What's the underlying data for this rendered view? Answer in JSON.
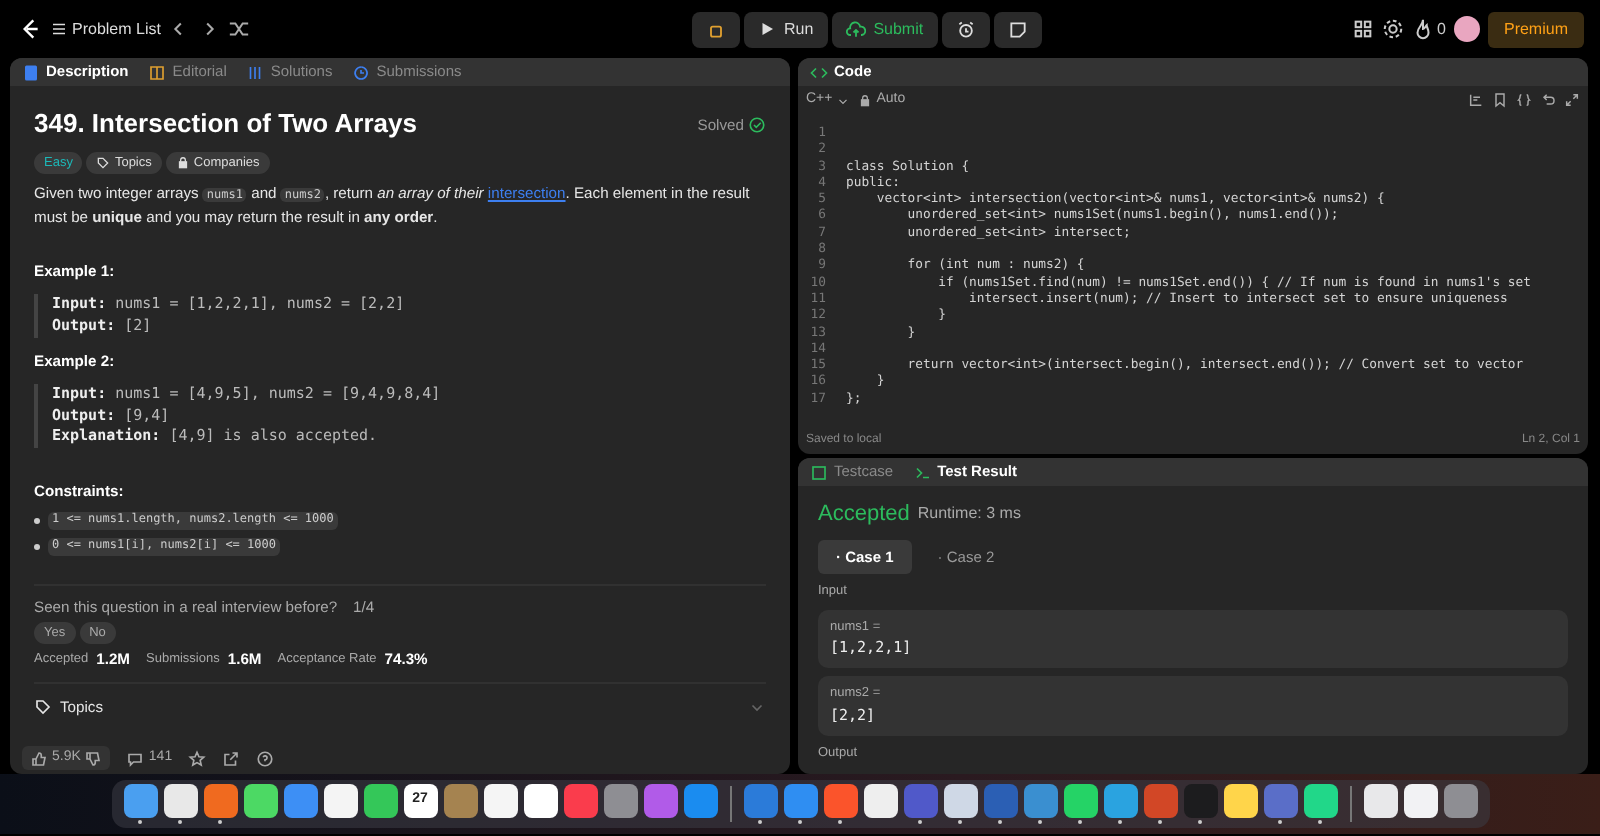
{
  "topbar": {
    "problem_list": "Problem List",
    "run": "Run",
    "submit": "Submit",
    "streak": "0",
    "premium": "Premium"
  },
  "left_tabs": [
    {
      "label": "Description",
      "selected": true
    },
    {
      "label": "Editorial",
      "selected": false
    },
    {
      "label": "Solutions",
      "selected": false
    },
    {
      "label": "Submissions",
      "selected": false
    }
  ],
  "problem": {
    "title": "349. Intersection of Two Arrays",
    "status": "Solved",
    "difficulty": "Easy",
    "tags": [
      "Topics",
      "Companies"
    ],
    "description": [
      {
        "kind": "text",
        "text": "Given two integer arrays "
      },
      {
        "kind": "code",
        "text": "nums1"
      },
      {
        "kind": "text",
        "text": " and "
      },
      {
        "kind": "code",
        "text": "nums2"
      },
      {
        "kind": "text",
        "text": ", return *an array of their* "
      },
      {
        "kind": "link",
        "text": "intersection"
      },
      {
        "kind": "text",
        "text": ". Each element in the result must be **unique** and you may return the result in **any order**."
      }
    ],
    "examples": [
      {
        "title": "Example 1:",
        "lines": [
          {
            "label": "Input:",
            "value": "nums1 = [1,2,2,1], nums2 = [2,2]"
          },
          {
            "label": "Output:",
            "value": "[2]"
          }
        ]
      },
      {
        "title": "Example 2:",
        "lines": [
          {
            "label": "Input:",
            "value": "nums1 = [4,9,5], nums2 = [9,4,9,8,4]"
          },
          {
            "label": "Output:",
            "value": "[9,4]"
          },
          {
            "label": "Explanation:",
            "value": "[4,9] is also accepted."
          }
        ]
      }
    ],
    "constraints_title": "Constraints:",
    "constraints": [
      "1 <= nums1.length, nums2.length <= 1000",
      "0 <= nums1[i], nums2[i] <= 1000"
    ],
    "interview_question": "Seen this question in a real interview before?",
    "interview_count": "1/4",
    "answers": [
      "Yes",
      "No"
    ],
    "stats": [
      {
        "label": "Accepted",
        "value": "1.2M"
      },
      {
        "label": "Submissions",
        "value": "1.6M"
      },
      {
        "label": "Acceptance Rate",
        "value": "74.3%"
      }
    ],
    "topics": "Topics"
  },
  "bottom_bar": {
    "likes": "5.9K",
    "comments": "141"
  },
  "code_panel": {
    "title": "Code",
    "language": "C++",
    "mode": "Auto",
    "status": "Saved to local",
    "cursor": "Ln 2, Col 1",
    "lines": [
      {
        "number": "1"
      },
      {
        "number": "2"
      },
      {
        "number": "3",
        "text": "class Solution {"
      },
      {
        "number": "4",
        "text": "public:"
      },
      {
        "number": "5",
        "text": "    vector<int> intersection(vector<int>& nums1, vector<int>& nums2) {"
      },
      {
        "number": "6",
        "text": "        unordered_set<int> nums1Set(nums1.begin(), nums1.end());"
      },
      {
        "number": "7",
        "text": "        unordered_set<int> intersect;"
      },
      {
        "number": "8"
      },
      {
        "number": "9",
        "text": "        for (int num : nums2) {"
      },
      {
        "number": "10",
        "text": "            if (nums1Set.find(num) != nums1Set.end()) { // If num is found in nums1's set"
      },
      {
        "number": "11",
        "text": "                intersect.insert(num); // Insert to intersect set to ensure uniqueness"
      },
      {
        "number": "12",
        "text": "            }"
      },
      {
        "number": "13",
        "text": "        }"
      },
      {
        "number": "14"
      },
      {
        "number": "15",
        "text": "        return vector<int>(intersect.begin(), intersect.end()); // Convert set to vector"
      },
      {
        "number": "16",
        "text": "    }"
      },
      {
        "number": "17",
        "text": "};"
      }
    ]
  },
  "result_tabs": [
    {
      "label": "Testcase",
      "selected": false
    },
    {
      "label": "Test Result",
      "selected": true
    }
  ],
  "result": {
    "verdict": "Accepted",
    "runtime": "Runtime: 3 ms",
    "cases": [
      {
        "label": "· Case 1",
        "selected": true
      },
      {
        "label": "· Case 2",
        "selected": false
      }
    ],
    "input_label": "Input",
    "inputs": [
      {
        "name": "nums1 =",
        "value": "[1,2,2,1]"
      },
      {
        "name": "nums2 =",
        "value": "[2,2]"
      }
    ],
    "output_label": "Output"
  },
  "dock": [
    {
      "color": "#4a9ff0",
      "running": true
    },
    {
      "color": "#e8e8e8",
      "running": true
    },
    {
      "color": "#f06a1f",
      "running": true
    },
    {
      "color": "#4cd964",
      "running": false
    },
    {
      "color": "#3d8ff5",
      "running": false
    },
    {
      "color": "#f4f4f4",
      "running": false
    },
    {
      "color": "#34c759",
      "running": false
    },
    {
      "color": "#ffffff",
      "running": false,
      "label": "27"
    },
    {
      "color": "#a58350",
      "running": false
    },
    {
      "color": "#f5f5f5",
      "running": false
    },
    {
      "color": "#ffffff",
      "running": false
    },
    {
      "color": "#fa3c4c",
      "running": false
    },
    {
      "color": "#8e8e93",
      "running": false
    },
    {
      "color": "#b15be8",
      "running": false
    },
    {
      "color": "#1a8cf0",
      "running": false
    },
    {
      "color": "#2b7bd9",
      "running": true
    },
    {
      "color": "#2f8ef2",
      "running": true
    },
    {
      "color": "#fb542b",
      "running": true
    },
    {
      "color": "#eeeeee",
      "running": false
    },
    {
      "color": "#5059c9",
      "running": true
    },
    {
      "color": "#cfd8e6",
      "running": true
    },
    {
      "color": "#2b5fb4",
      "running": true
    },
    {
      "color": "#3a8fd0",
      "running": true
    },
    {
      "color": "#25d366",
      "running": true
    },
    {
      "color": "#2aa3e0",
      "running": true
    },
    {
      "color": "#d24726",
      "running": true
    },
    {
      "color": "#1c1c1e",
      "running": true
    },
    {
      "color": "#ffd54a",
      "running": false
    },
    {
      "color": "#5a6ec8",
      "running": true
    },
    {
      "color": "#21d789",
      "running": true
    },
    {
      "color": "#e8e8ea",
      "running": false
    },
    {
      "color": "#f2f2f4",
      "running": false
    },
    {
      "color": "#8e8e93",
      "running": false
    }
  ]
}
